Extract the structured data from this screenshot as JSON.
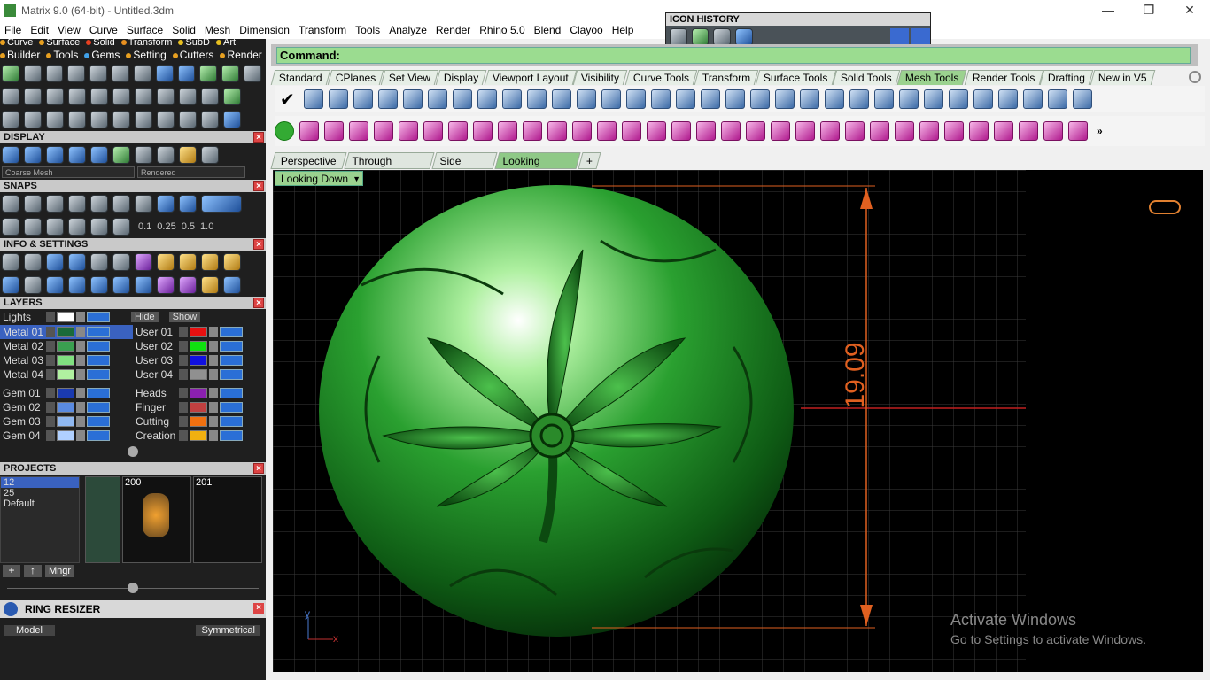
{
  "window": {
    "title": "Matrix 9.0 (64-bit) - Untitled.3dm",
    "min_icon": "minimize-icon",
    "max_icon": "restore-icon",
    "close_icon": "close-icon"
  },
  "menu": [
    "File",
    "Edit",
    "View",
    "Curve",
    "Surface",
    "Solid",
    "Mesh",
    "Dimension",
    "Transform",
    "Tools",
    "Analyze",
    "Render",
    "Rhino 5.0",
    "Blend",
    "Clayoo",
    "Help"
  ],
  "categories_row1": [
    {
      "label": "Curve",
      "color": "#e8a020"
    },
    {
      "label": "Surface",
      "color": "#e8a020"
    },
    {
      "label": "Solid",
      "color": "#e84020"
    },
    {
      "label": "Transform",
      "color": "#e89020"
    },
    {
      "label": "SubD",
      "color": "#e8c020"
    },
    {
      "label": "Art",
      "color": "#e8c020"
    }
  ],
  "categories_row2": [
    {
      "label": "Builder",
      "color": "#e8a020"
    },
    {
      "label": "Tools",
      "color": "#e8a020"
    },
    {
      "label": "Gems",
      "color": "#40a0e8"
    },
    {
      "label": "Setting",
      "color": "#e8a020"
    },
    {
      "label": "Cutters",
      "color": "#e8a020"
    },
    {
      "label": "Render",
      "color": "#e8a020"
    }
  ],
  "display": {
    "title": "DISPLAY",
    "mesh_select": "Coarse Mesh",
    "render_select": "Rendered"
  },
  "snaps": {
    "title": "SNAPS",
    "values": [
      "0.1",
      "0.25",
      "0.5",
      "1.0"
    ]
  },
  "info": {
    "title": "INFO & SETTINGS"
  },
  "layers": {
    "title": "LAYERS",
    "lights_label": "Lights",
    "hide_label": "Hide",
    "show_label": "Show",
    "left": [
      {
        "name": "Metal 01",
        "color": "#1a6a3a"
      },
      {
        "name": "Metal 02",
        "color": "#3aa050"
      },
      {
        "name": "Metal 03",
        "color": "#80e080"
      },
      {
        "name": "Metal 04",
        "color": "#b0f0a0"
      },
      {
        "name": "Gem 01",
        "color": "#1a3ab0"
      },
      {
        "name": "Gem 02",
        "color": "#5a8ae0"
      },
      {
        "name": "Gem 03",
        "color": "#90b8f0"
      },
      {
        "name": "Gem 04",
        "color": "#b0d0ff"
      }
    ],
    "right": [
      {
        "name": "User 01",
        "color": "#e81010"
      },
      {
        "name": "User 02",
        "color": "#10e010"
      },
      {
        "name": "User 03",
        "color": "#1010e0"
      },
      {
        "name": "User 04",
        "color": "#909090"
      },
      {
        "name": "Heads",
        "color": "#8a20b0"
      },
      {
        "name": "Finger",
        "color": "#c04040"
      },
      {
        "name": "Cutting",
        "color": "#f07010"
      },
      {
        "name": "Creation",
        "color": "#f0b010"
      }
    ]
  },
  "projects": {
    "title": "PROJECTS",
    "items": [
      "12",
      "25",
      "Default"
    ],
    "thumbs": [
      "200",
      "201"
    ],
    "mngr_label": "Mngr"
  },
  "ring_resizer": {
    "title": "RING RESIZER",
    "model_label": "Model",
    "sym_label": "Symmetrical"
  },
  "icon_history": {
    "title": "ICON HISTORY"
  },
  "command": {
    "label": "Command:"
  },
  "toolbar_tabs": [
    "Standard",
    "CPlanes",
    "Set View",
    "Display",
    "Viewport Layout",
    "Visibility",
    "Curve Tools",
    "Transform",
    "Surface Tools",
    "Solid Tools",
    "Mesh Tools",
    "Render Tools",
    "Drafting",
    "New in V5"
  ],
  "active_toolbar_tab": "Mesh Tools",
  "viewport_tabs": [
    "Perspective",
    "Through Finger",
    "Side View",
    "Looking Down"
  ],
  "active_viewport_tab": "Looking Down",
  "viewport_label": "Looking Down",
  "dimension_value": "19.09",
  "axis": {
    "x": "x",
    "y": "y"
  },
  "watermark": {
    "line1": "Activate Windows",
    "line2": "Go to Settings to activate Windows."
  }
}
